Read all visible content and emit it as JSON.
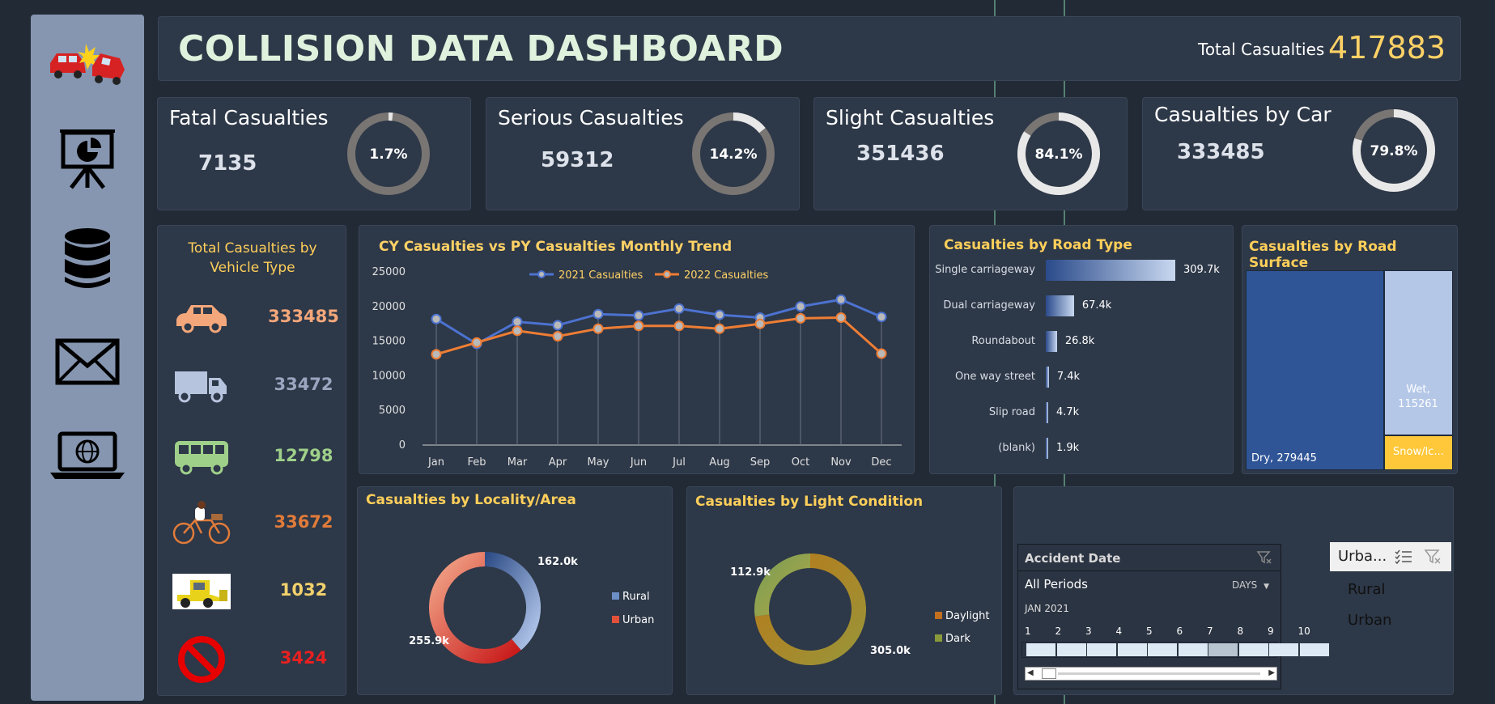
{
  "header": {
    "title": "COLLISION DATA DASHBOARD",
    "total_label": "Total Casualties",
    "total_value": "417883"
  },
  "kpis": [
    {
      "label": "Fatal Casualties",
      "value": "7135",
      "pct_text": "1.7%",
      "pct": 1.7
    },
    {
      "label": "Serious Casualties",
      "value": "59312",
      "pct_text": "14.2%",
      "pct": 14.2
    },
    {
      "label": "Slight Casualties",
      "value": "351436",
      "pct_text": "84.1%",
      "pct": 84.1
    },
    {
      "label": "Casualties by Car",
      "value": "333485",
      "pct_text": "79.8%",
      "pct": 79.8
    }
  ],
  "vehicle": {
    "title": "Total Casualties by Vehicle Type",
    "items": [
      {
        "icon": "car-icon",
        "value": "333485",
        "color": "#f4a77a"
      },
      {
        "icon": "truck-icon",
        "value": "33472",
        "color": "#9aa6bf"
      },
      {
        "icon": "bus-icon",
        "value": "12798",
        "color": "#9fd08a"
      },
      {
        "icon": "bicycle-icon",
        "value": "33672",
        "color": "#e07b3a"
      },
      {
        "icon": "tractor-icon",
        "value": "1032",
        "color": "#f2d16b"
      },
      {
        "icon": "no-entry-icon",
        "value": "3424",
        "color": "#e82020"
      }
    ]
  },
  "trend": {
    "title": "CY Casualties vs PY Casualties Monthly Trend",
    "chart_data": {
      "type": "line",
      "x": [
        "Jan",
        "Feb",
        "Mar",
        "Apr",
        "May",
        "Jun",
        "Jul",
        "Aug",
        "Sep",
        "Oct",
        "Nov",
        "Dec"
      ],
      "series": [
        {
          "name": "2021 Casualties",
          "color": "#4c72d0",
          "values": [
            18200,
            14600,
            17800,
            17300,
            18900,
            18700,
            19700,
            18800,
            18400,
            20000,
            21000,
            18500
          ]
        },
        {
          "name": "2022 Casualties",
          "color": "#ee7d34",
          "values": [
            13100,
            14800,
            16500,
            15700,
            16800,
            17200,
            17200,
            16800,
            17500,
            18300,
            18400,
            13200
          ]
        }
      ],
      "y_ticks": [
        "0",
        "5000",
        "10000",
        "15000",
        "20000",
        "25000"
      ],
      "ylim": [
        0,
        25000
      ],
      "legend": "top"
    }
  },
  "road_type": {
    "title": "Casualties by Road Type",
    "chart_data": {
      "type": "bar",
      "categories": [
        "Single carriageway",
        "Dual carriageway",
        "Roundabout",
        "One way street",
        "Slip road",
        "(blank)"
      ],
      "values": [
        309.7,
        67.4,
        26.8,
        7.4,
        4.7,
        1.9
      ],
      "labels": [
        "309.7k",
        "67.4k",
        "26.8k",
        "7.4k",
        "4.7k",
        "1.9k"
      ]
    }
  },
  "road_surface": {
    "title": "Casualties by Road Surface",
    "chart_data": {
      "type": "treemap",
      "items": [
        {
          "label": "Dry, 279445",
          "value": 279445,
          "color": "#2f5597"
        },
        {
          "label": "Wet, 115261",
          "value": 115261,
          "color": "#b4c7e7"
        },
        {
          "label": "Snow/Ic...",
          "value": 23177,
          "color": "#ffc83a"
        }
      ]
    }
  },
  "locality": {
    "title": "Casualties by Locality/Area",
    "chart_data": {
      "type": "pie",
      "slices": [
        {
          "name": "Rural",
          "value": 162.0,
          "label": "162.0k",
          "color": "#6d8fc8"
        },
        {
          "name": "Urban",
          "value": 255.9,
          "label": "255.9k",
          "color": "#e2503a"
        }
      ]
    }
  },
  "light": {
    "title": "Casualties by Light Condition",
    "chart_data": {
      "type": "pie",
      "slices": [
        {
          "name": "Daylight",
          "value": 305.0,
          "label": "305.0k",
          "color": "#c0701e"
        },
        {
          "name": "Dark",
          "value": 112.9,
          "label": "112.9k",
          "color": "#8a9a3a"
        }
      ]
    }
  },
  "slicer": {
    "title": "Accident Date",
    "period": "All Periods",
    "unit": "DAYS",
    "month": "JAN 2021",
    "days": [
      "1",
      "2",
      "3",
      "4",
      "5",
      "6",
      "7",
      "8",
      "9",
      "10"
    ]
  },
  "area_slicer": {
    "title": "Urba...",
    "options": [
      "Rural",
      "Urban"
    ]
  }
}
